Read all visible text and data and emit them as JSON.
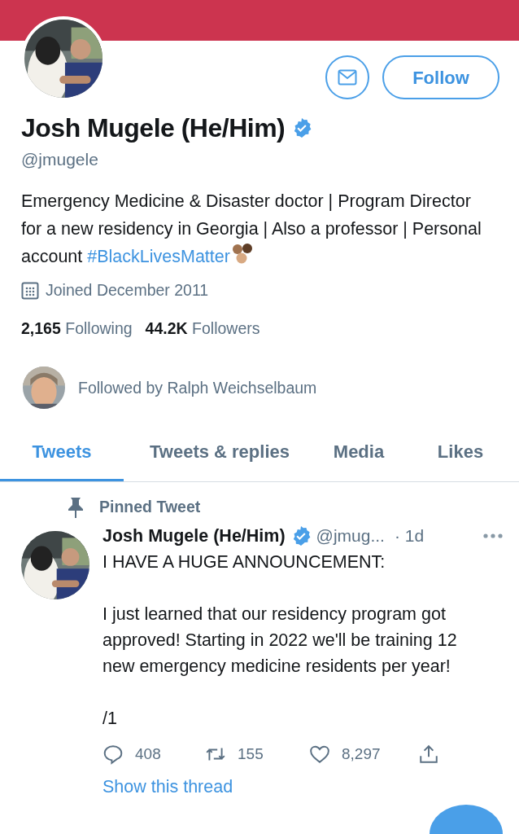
{
  "profile": {
    "name": "Josh Mugele (He/Him)",
    "verified": true,
    "handle": "@jmugele",
    "bio": {
      "text": "Emergency Medicine & Disaster doctor | Program Director for a new residency in Georgia | Also a professor | Personal account ",
      "hashtag": "#BlackLivesMatter"
    },
    "joined": "Joined December 2011",
    "stats": [
      {
        "count": "2,165",
        "label": "Following"
      },
      {
        "count": "44.2K",
        "label": "Followers"
      }
    ],
    "followed_by": "Followed by Ralph Weichselbaum",
    "follow_button": "Follow"
  },
  "tabs": [
    {
      "label": "Tweets",
      "selected": true
    },
    {
      "label": "Tweets & replies",
      "selected": false
    },
    {
      "label": "Media",
      "selected": false
    },
    {
      "label": "Likes",
      "selected": false
    }
  ],
  "tweet": {
    "pinned_label": "Pinned Tweet",
    "name": "Josh Mugele (He/Him)",
    "verified": true,
    "handle": "@jmug...",
    "time": "· 1d",
    "text": "I HAVE A HUGE ANNOUNCEMENT:\n\nI just learned that our residency program got approved! Starting in 2022 we'll be training 12 new emergency medicine residents per year!\n\n/1",
    "actions": [
      {
        "kind": "reply",
        "count": "408"
      },
      {
        "kind": "retweet",
        "count": "155"
      },
      {
        "kind": "like",
        "count": "8,297"
      },
      {
        "kind": "share"
      }
    ],
    "thread_link": "Show this thread"
  }
}
